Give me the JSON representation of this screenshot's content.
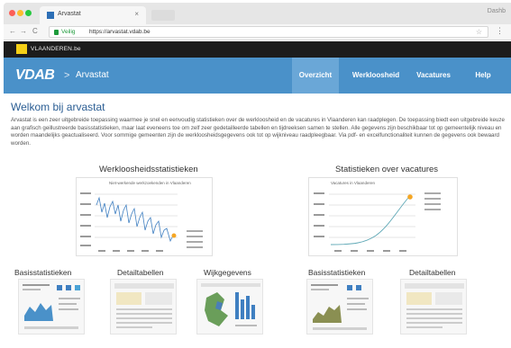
{
  "browser": {
    "tab_title": "Arvastat",
    "tab_close": "×",
    "profile": "Dashb",
    "back": "←",
    "forward": "→",
    "reload": "C",
    "secure_label": "Veilig",
    "url": "https://arvastat.vdab.be",
    "star": "☆",
    "menu": "⋮"
  },
  "vlaanderen": {
    "label": "VLAANDEREN.be"
  },
  "header": {
    "logo": "VDAB",
    "separator": ">",
    "breadcrumb": "Arvastat",
    "nav": [
      "Overzicht",
      "Werkloosheid",
      "Vacatures",
      "Help"
    ],
    "active_nav": "Overzicht",
    "accent": "#4a91c9"
  },
  "main": {
    "title": "Welkom bij arvastat",
    "intro": "Arvastat is een zeer uitgebreide toepassing waarmee je snel en eenvoudig statistieken over de werkloosheid en de vacatures in Vlaanderen kan raadplegen. De toepassing biedt een uitgebreide keuze aan grafisch geillustreerde basisstatistieken, maar laat eveneens toe om zelf zeer gedetailleerde tabellen en tijdreeksen samen te stellen. Alle gegevens zijn beschikbaar tot op gemeentelijk niveau en worden maandelijks geactualiseerd. Voor sommige gemeenten zijn de werkloosheidsgegevens ook tot op wijkniveau raadpleegbaar. Via pdf- en excelfunctionaliteit kunnen de gegevens ook bewaard worden."
  },
  "charts": [
    {
      "title": "Werkloosheidsstatistieken",
      "subtitle": "Niet-werkende werkzoekenden in Vlaanderen"
    },
    {
      "title": "Statistieken over vacatures",
      "subtitle": "Vacatures in Vlaanderen"
    }
  ],
  "thumbnails": [
    "Basisstatistieken",
    "Detailtabellen",
    "Wijkgegevens",
    "Basisstatistieken",
    "Detailtabellen"
  ]
}
